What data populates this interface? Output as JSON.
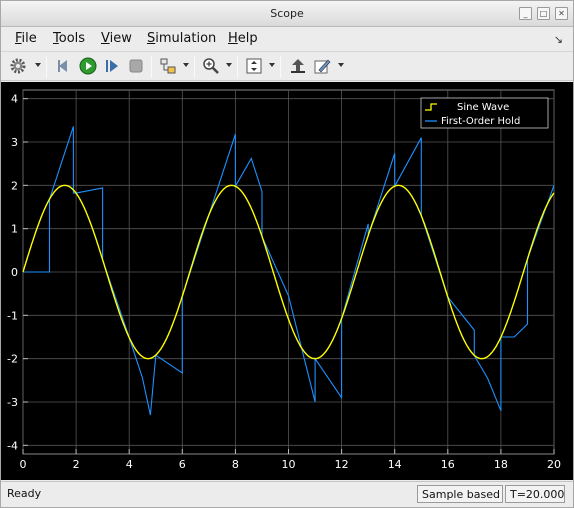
{
  "window": {
    "title": "Scope"
  },
  "menu": {
    "items": [
      {
        "label": "File",
        "mnemonic": "F",
        "rest": "ile"
      },
      {
        "label": "Tools",
        "mnemonic": "T",
        "rest": "ools"
      },
      {
        "label": "View",
        "mnemonic": "V",
        "rest": "iew"
      },
      {
        "label": "Simulation",
        "mnemonic": "S",
        "rest": "imulation"
      },
      {
        "label": "Help",
        "mnemonic": "H",
        "rest": "elp"
      }
    ]
  },
  "toolbar": {
    "icons": [
      "settings-icon",
      "step-back-icon",
      "run-icon",
      "step-forward-icon",
      "stop-icon",
      "highlight-block-icon",
      "zoom-in-icon",
      "scale-axes-icon",
      "restore-view-icon",
      "style-icon"
    ]
  },
  "status": {
    "ready": "Ready",
    "sample_mode": "Sample based",
    "time": "T=20.000"
  },
  "colors": {
    "background": "#000000",
    "grid": "#555555",
    "axis_text": "#ffffff",
    "sine": "#ffff00",
    "foh": "#1e90ff"
  },
  "chart_data": {
    "type": "line",
    "title": "",
    "xlabel": "",
    "ylabel": "",
    "xlim": [
      0,
      20
    ],
    "ylim": [
      -4.2,
      4.2
    ],
    "xticks": [
      "0",
      "2",
      "4",
      "6",
      "8",
      "10",
      "12",
      "14",
      "16",
      "18",
      "20"
    ],
    "yticks": [
      "4",
      "3",
      "2",
      "1",
      "0",
      "-1",
      "-2",
      "-3",
      "-4"
    ],
    "grid": true,
    "legend_position": "top-right",
    "series": [
      {
        "name": "Sine Wave",
        "color": "#ffff00",
        "function": "2*sin(t)",
        "t_range": [
          0,
          20
        ]
      },
      {
        "name": "First-Order Hold",
        "color": "#1e90ff",
        "x": [
          0,
          1,
          1,
          1.9,
          1.9,
          2,
          3,
          3,
          4,
          4.5,
          4.8,
          5,
          5,
          6,
          6,
          7,
          8,
          8,
          8.6,
          9,
          9,
          10,
          10,
          11,
          11,
          12,
          12,
          13,
          13,
          14,
          14,
          15,
          15,
          16,
          16,
          17,
          17,
          17.5,
          18,
          18,
          18.5,
          19,
          19,
          20
        ],
        "y": [
          0,
          0,
          1.68,
          3.36,
          1.82,
          1.82,
          1.94,
          0.28,
          -1.51,
          -2.45,
          -3.3,
          -1.92,
          -1.92,
          -2.33,
          -0.56,
          1.31,
          3.18,
          1.98,
          2.62,
          1.86,
          0.82,
          -0.55,
          -0.55,
          -3.0,
          -2.0,
          -2.9,
          -1.07,
          1.11,
          0.84,
          2.74,
          1.98,
          3.1,
          1.3,
          -0.58,
          -0.58,
          -1.34,
          -1.93,
          -2.45,
          -3.2,
          -1.5,
          -1.5,
          -1.2,
          0.3,
          2.0
        ]
      }
    ]
  }
}
